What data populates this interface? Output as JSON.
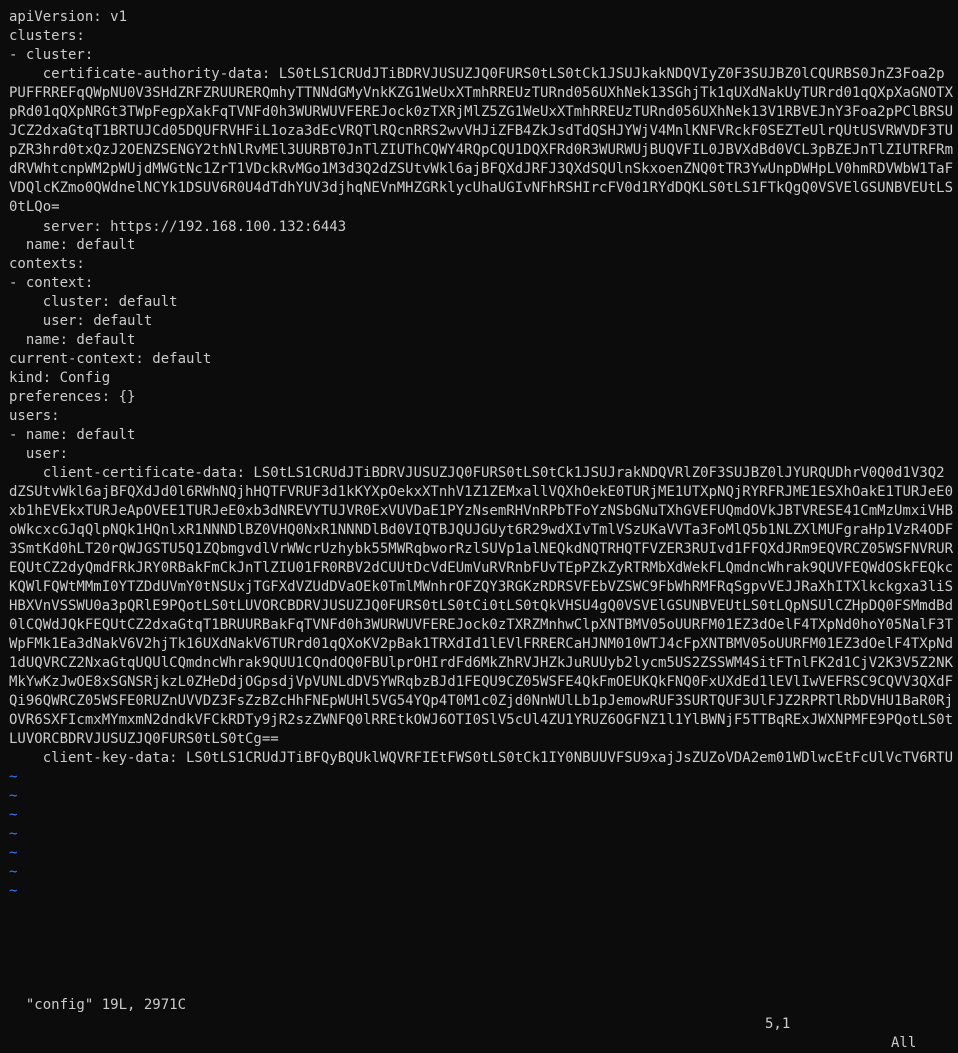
{
  "editor": {
    "lines": [
      "apiVersion: v1",
      "clusters:",
      "- cluster:",
      "    certificate-authority-data: LS0tLS1CRUdJTiBDRVJUSUZJQ0FURS0tLS0tCk1JSUJkakNDQVIyZ0F3SUJBZ0lCQURBS0JnZ3Foa2pPUFFRREFqQWpNU0V3SHdZRFZRUURERQmhyTTNNdGMyVnkKZG1WeUxXTmhRREUzTURnd056UXhNek13SGhjTk1qUXdNakUyTURrd01qQXpXaGNOTXpRd01qQXpNRGt3TWpFegpXakFqTVNFd0h3WURWUVFEREJock0zTXRjMlZ5ZG1WeUxXTmhRREUzTURnd056UXhNek13V1RBVEJnY3Foa2pPClBRSUJCZ2dxaGtqT1BRTUJCd05DQUFRVHFiL1oza3dEcVRQTlRQcnRRS2wvVHJiZFB4ZkJsdTdQSHJYWjV4MnlKNFVRckF0SEZTeUlrQUtUSVRWVDF3TUpZR3hrd0txQzJ2OENZSENGY2thNlRvMEl3UURBT0JnTlZIUThCQWY4RQpCQU1DQXFRd0R3WURWUjBUQVFIL0JBVXdBd0VCL3pBZEJnTlZIUTRFRmdRVWhtcnpWM2pWUjdMWGtNc1ZrT1VDckRvMGo1M3d3Q2dZSUtvWkl6ajBFQXdJRFJ3QXdSQUlnSkxoenZNQ0tTR3YwUnpDWHpLV0hmRDVWbW1TaFVDQlcKZmo0QWdnelNCYk1DSUV6R0U4dTdhYUV3djhqNEVnMHZGRklycUhaUGIvNFhRSHIrcFV0d1RYdDQKLS0tLS1FTkQgQ0VSVElGSUNBVEUtLS0tLQo=",
      "    server: https://192.168.100.132:6443",
      "  name: default",
      "contexts:",
      "- context:",
      "    cluster: default",
      "    user: default",
      "  name: default",
      "current-context: default",
      "kind: Config",
      "preferences: {}",
      "users:",
      "- name: default",
      "  user:",
      "    client-certificate-data: LS0tLS1CRUdJTiBDRVJUSUZJQ0FURS0tLS0tCk1JSUJrakNDQVRlZ0F3SUJBZ0lJYURQUDhrV0Q0d1V3Q2dZSUtvWkl6ajBFQXdJd0l6RWhNQjhHQTFVRUF3d1kKYXpOekxXTnhV1Z1ZEMxallVQXhOekE0TURjME1UTXpNQjRYRFRJME1ESXhOakE1TURJeE0xb1hEVEkxTURJeApOVEE1TURJeE0xb3dNREVYTUJVR0ExVUVDaE1PYzNsemRHVnRPbTFoYzNSbGNuTXhGVEFUQmdOVkJBTVRESE41CmMzUmxiVHBoWkcxcGJqQlpNQk1HQnlxR1NNNDlBZ0VHQ0NxR1NNNDlBd0VIQTBJQUJGUyt6R29wdXIvTmlVSzUKaVVTa3FoMlQ5b1NLZXlMUFgraHp1VzR4ODF3SmtKd0hLT20rQWJGSTU5Q1ZQbmgvdlVrWWcrUzhybk55MWRqbworRzlSUVp1alNEQkdNQTRHQTFVZER3RUIvd1FFQXdJRm9EQVRCZ05WSFNVRUREQUtCZ2dyQmdFRkJRY0RBakFmCkJnTlZIU01FR0RBV2dCUUtDcVdEUmVuRVRnbFUvTEpPZkZyRTRMbXdWekFLQmdncWhrak9QUVFEQWdOSkFEQkcKQWlFQWtMMmI0YTZDdUVmY0tNSUxjTGFXdVZUdDVaOEk0TmlMWnhrOFZQY3RGKzRDRSVFEbVZSWC9FbWhRMFRqSgpvVEJJRaXhITXlkckgxa3liSHBXVnVSSWU0a3pQRlE9PQotLS0tLUVORCBDRVJUSUZJQ0FURS0tLS0tCi0tLS0tQkVHSU4gQ0VSVElGSUNBVEUtLS0tLQpNSUlCZHpDQ0FSMmdBd0lCQWdJQkFEQUtCZ2dxaGtqT1BRUURBakFqTVNFd0h3WURWUVFEREJock0zTXRZMnhwClpXNTBMV05oUURFM01EZ3dOelF4TXpNd0hoY05NalF3TWpFMk1Ea3dNakV6V2hjTk16UXdNakV6TURrd01qQXoKV2pBak1TRXdId1lEVlFRRERCaHJNM010WTJ4cFpXNTBMV05oUURFM01EZ3dOelF4TXpNd1dUQVRCZ2NxaGtqUQUlCQmdncWhrak9QUU1CQndOQ0FBUlprOHIrdFd6MkZhRVJHZkJuRUUyb2lycm5US2ZSSWM4SitFTnlFK2d1CjV2K3V5Z2NKMkYwKzJwOE8xSGNSRjkzL0ZHeDdjOGpsdjVpVUNLdDV5YWRqbzBJd1FEQU9CZ05WSFE4QkFmOEUKQkFNQ0FxUXdEd1lEVlIwVEFRSC9CQVV3QXdFQi96QWRCZ05WSFE0RUZnUVVDZ3FsZzBZcHhFNEpWUHl5VG54YQp4T0M1c0Zjd0NnWUlLb1pJemowRUF3SURTQUF3UlFJZ2RPRTlRbDVHU1BaR0RjOVR6SXFIcmxMYmxmN2dndkVFCkRDTy9jR2szZWNFQ0lRREtkOWJ6OTI0SlV5cUl4ZU1YRUZ6OGFNZ1l1YlBWNjF5TTBqRExJWXNPMFE9PQotLS0tLUVORCBDRVJUSUZJQ0FURS0tLS0tCg==",
      "    client-key-data: LS0tLS1CRUdJTiBFQyBQUklWQVRFIEtFWS0tLS0tCk1IY0NBUUVFSU9xajJsZUZoVDA2em01WDlwcEtFcUlVcTV6RTUvVlZzdzQwTmloWVBoUlZvQW9HQ0NxR1NNNDkKQXdFSG9VUURRZ0FFVkw3TWFpbTZ2ODJKUXJtSlJLU3FIWlAyaElwN0lzOWY2SE81YmpIelhBbVFuQWNvNmI0QgpzVWpuMEpVK2VIKzlTUmlENUx5dWMzTFYyT2o0YjFGQm13PT0KLS0tLS1FTkQgRUMgUFJJVkFURSBLRVktLS0tLQo="
    ],
    "empty_line_marker": "~",
    "empty_line_count": 7
  },
  "status": {
    "file_info": "\"config\" 19L, 2971C",
    "cursor_position": "5,1",
    "scroll_position": "All"
  },
  "colors": {
    "background": "#0c0c0c",
    "text": "#cccccc",
    "tilde": "#3b78ff"
  }
}
